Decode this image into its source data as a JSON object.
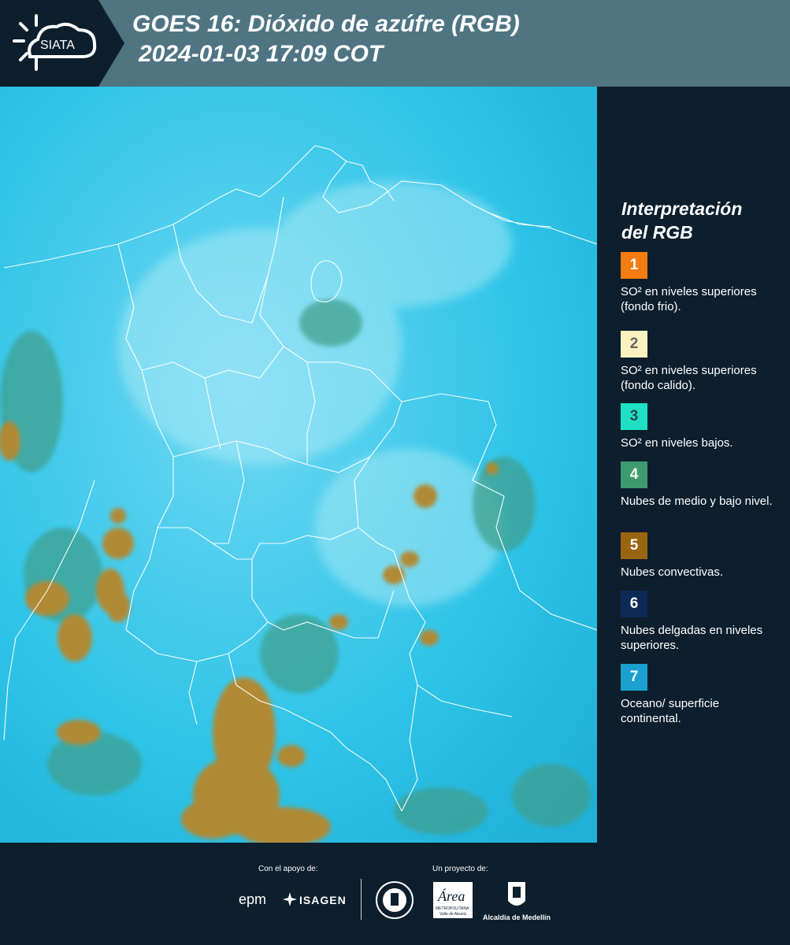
{
  "header": {
    "logo_text": "SIATA",
    "title_line1": "GOES 16: Dióxido de azúfre (RGB)",
    "title_line2": "2024-01-03 17:09 COT"
  },
  "map": {
    "background_color": "#2fc4e8",
    "cloud_color": "#b18a36",
    "border_color": "#ffffff"
  },
  "legend": {
    "title_line1": "Interpretación",
    "title_line2": "del RGB",
    "items": [
      {
        "number": "1",
        "color": "#f57c12",
        "text_color": "#ffffff",
        "label": "SO² en niveles superiores (fondo frio)."
      },
      {
        "number": "2",
        "color": "#fbf2c0",
        "text_color": "#666666",
        "label": "SO² en niveles superiores (fondo calido)."
      },
      {
        "number": "3",
        "color": "#1fe0c4",
        "text_color": "#2a4a48",
        "label": "SO² en niveles bajos."
      },
      {
        "number": "4",
        "color": "#3d9a6c",
        "text_color": "#ffffff",
        "label": "Nubes de medio y bajo nivel."
      },
      {
        "number": "5",
        "color": "#9a6510",
        "text_color": "#ffffff",
        "label": "Nubes convectivas."
      },
      {
        "number": "6",
        "color": "#0d2a57",
        "text_color": "#ffffff",
        "label": "Nubes delgadas en niveles superiores."
      },
      {
        "number": "7",
        "color": "#1aa1cf",
        "text_color": "#ffffff",
        "label": "Oceano/ superficie continental."
      }
    ]
  },
  "footer": {
    "support_label": "Con el apoyo de:",
    "project_label": "Un proyecto de:",
    "epm": "epm",
    "isagen": "ISAGEN",
    "area_label": "Área",
    "area_sub": "METROPOLITANA",
    "area_sub2": "Valle de Aburrá",
    "alcaldia": "Alcaldía de Medellín"
  }
}
